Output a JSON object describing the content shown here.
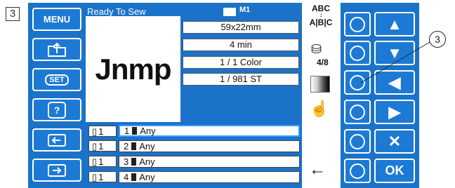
{
  "step_label": "3",
  "callout_label": "3",
  "status": {
    "text": "Ready To Sew",
    "memory": "M1"
  },
  "preview": {
    "text": "Jnmp"
  },
  "info": [
    "59x22mm",
    "4 min",
    "1 / 1 Color",
    "1 / 981 ST"
  ],
  "left_buttons": [
    {
      "id": "menu",
      "label": "MENU",
      "icon": "menu-text"
    },
    {
      "id": "open-file",
      "label": "",
      "icon": "folder-open-icon"
    },
    {
      "id": "set",
      "label": "SET",
      "icon": "set-icon"
    },
    {
      "id": "help",
      "label": "?",
      "icon": "help-icon"
    },
    {
      "id": "transfer-out",
      "label": "",
      "icon": "transfer-out-icon"
    },
    {
      "id": "transfer-in",
      "label": "",
      "icon": "transfer-in-icon"
    }
  ],
  "right_strip": {
    "abc_top": "ABC",
    "abc_bottom": "A|B|C",
    "spool_count": "4/8",
    "back_arrow": "←"
  },
  "arrow_buttons": [
    {
      "id": "up",
      "label": "▲"
    },
    {
      "id": "down",
      "label": "▼"
    },
    {
      "id": "left",
      "label": "◀"
    },
    {
      "id": "right",
      "label": "▶"
    },
    {
      "id": "cancel",
      "label": "✕"
    },
    {
      "id": "ok",
      "label": "OK"
    }
  ],
  "slots": [
    {
      "needle": "1",
      "index": "1",
      "color": "Any",
      "selected": true
    },
    {
      "needle": "1",
      "index": "2",
      "color": "Any",
      "selected": false
    },
    {
      "needle": "1",
      "index": "3",
      "color": "Any",
      "selected": false
    },
    {
      "needle": "1",
      "index": "4",
      "color": "Any",
      "selected": false
    }
  ],
  "colors": {
    "frame": "#1a72c9",
    "button": "#1d7ad4",
    "selected_border": "#3a9bff"
  }
}
